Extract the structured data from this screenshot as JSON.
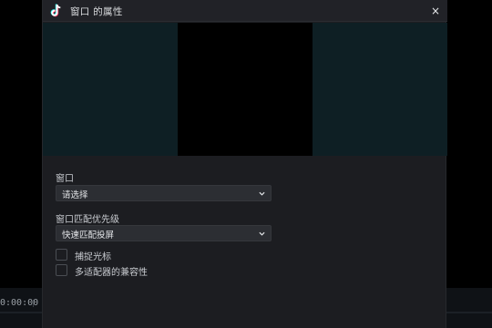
{
  "background": {
    "timecode": "0:00:00"
  },
  "dialog": {
    "title": "窗口 的属性",
    "close_glyph": "×",
    "logo_icon": "tiktok-logo-icon"
  },
  "form": {
    "window": {
      "label": "窗口",
      "value": "请选择"
    },
    "priority": {
      "label": "窗口匹配优先级",
      "value": "快速匹配投屏"
    },
    "checkboxes": [
      {
        "label": "捕捉光标",
        "checked": false
      },
      {
        "label": "多适配器的兼容性",
        "checked": false
      }
    ]
  },
  "colors": {
    "preview_bg": "#0e1f24",
    "dialog_bg": "#1c1d21",
    "select_bg": "#2c2e33"
  }
}
